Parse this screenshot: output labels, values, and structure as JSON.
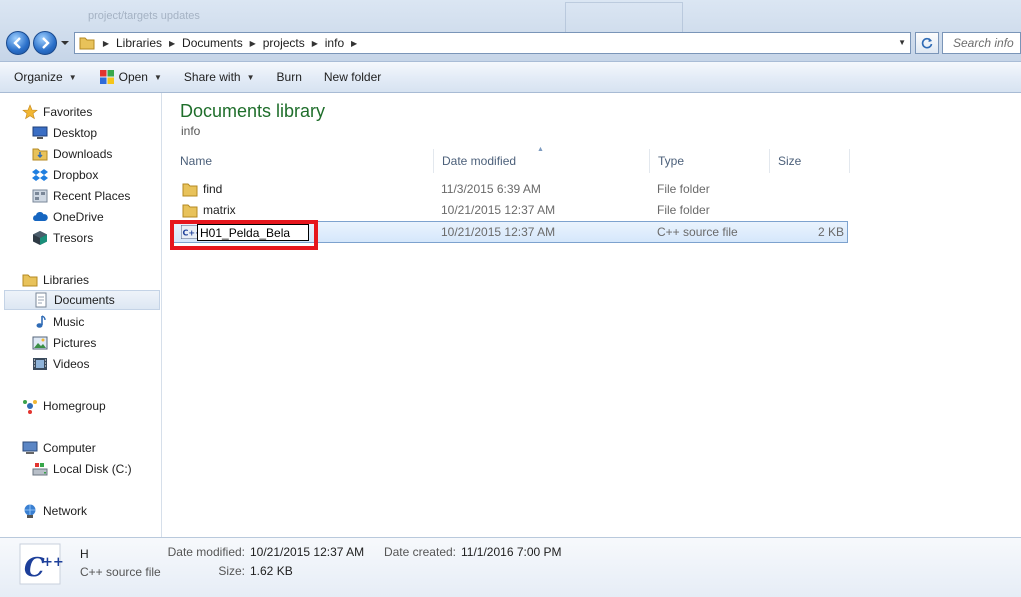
{
  "window": {
    "ghost_title": "project/targets updates"
  },
  "address": {
    "crumbs": [
      "Libraries",
      "Documents",
      "projects",
      "info"
    ],
    "search_placeholder": "Search info"
  },
  "toolbar": {
    "organize": "Organize",
    "open": "Open",
    "share_with": "Share with",
    "burn": "Burn",
    "new_folder": "New folder"
  },
  "nav": {
    "favorites": "Favorites",
    "desktop": "Desktop",
    "downloads": "Downloads",
    "dropbox": "Dropbox",
    "recent_places": "Recent Places",
    "onedrive": "OneDrive",
    "tresors": "Tresors",
    "libraries": "Libraries",
    "documents": "Documents",
    "music": "Music",
    "pictures": "Pictures",
    "videos": "Videos",
    "homegroup": "Homegroup",
    "computer": "Computer",
    "local_disk": "Local Disk (C:)",
    "network": "Network"
  },
  "content": {
    "title": "Documents library",
    "subtitle": "info",
    "columns": {
      "name": "Name",
      "date_modified": "Date modified",
      "type": "Type",
      "size": "Size"
    },
    "rows": [
      {
        "name": "find",
        "date": "11/3/2015 6:39 AM",
        "type": "File folder",
        "size": ""
      },
      {
        "name": "matrix",
        "date": "10/21/2015 12:37 AM",
        "type": "File folder",
        "size": ""
      },
      {
        "name": "H01_Pelda_Bela",
        "date": "10/21/2015 12:37 AM",
        "type": "C++ source file",
        "size": "2 KB"
      }
    ]
  },
  "details": {
    "name": "H",
    "type": "C++ source file",
    "date_modified_label": "Date modified:",
    "date_modified": "10/21/2015 12:37 AM",
    "date_created_label": "Date created:",
    "date_created": "11/1/2016 7:00 PM",
    "size_label": "Size:",
    "size": "1.62 KB"
  },
  "colors": {
    "title_green": "#1f6e2b",
    "highlight_red": "#e6161d",
    "selection_blue": "#d5e7fb"
  }
}
